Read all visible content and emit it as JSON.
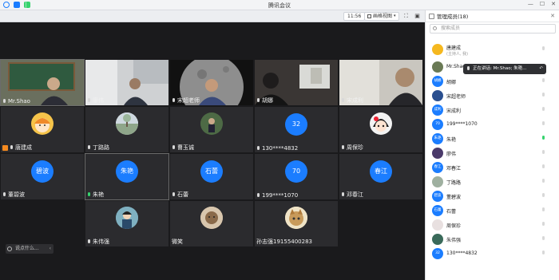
{
  "window": {
    "title": "腾讯会议",
    "close_symbol": "✕",
    "minimize_symbol": "—",
    "maximize_symbol": "☐"
  },
  "toolbar": {
    "time": "11:56",
    "view_label": "画格视图",
    "view_icon": "grid-icon"
  },
  "tiles": [
    {
      "name": "Mr.Shao",
      "kind": "video",
      "mic": "on"
    },
    {
      "name": "廖伟",
      "kind": "video",
      "mic": "on"
    },
    {
      "name": "宋超老师",
      "kind": "video",
      "mic": "on"
    },
    {
      "name": "胡娜",
      "kind": "video",
      "mic": "on"
    },
    {
      "name": "宋成利",
      "kind": "video",
      "mic": "on"
    },
    {
      "name": "唐建成",
      "kind": "avatar",
      "mic": "host"
    },
    {
      "name": "丁路路",
      "kind": "avatar",
      "mic": "on"
    },
    {
      "name": "曹玉诚",
      "kind": "avatar",
      "mic": "on"
    },
    {
      "name": "130****4832",
      "avatar_text": "32",
      "kind": "blue",
      "mic": "on"
    },
    {
      "name": "周保珍",
      "kind": "avatar",
      "mic": "on"
    },
    {
      "name": "董碧波",
      "avatar_text": "碧波",
      "kind": "blue",
      "mic": "on"
    },
    {
      "name": "朱艳",
      "avatar_text": "朱艳",
      "kind": "blue",
      "mic": "green"
    },
    {
      "name": "石蕾",
      "avatar_text": "石蕾",
      "kind": "blue",
      "mic": "on"
    },
    {
      "name": "199****1070",
      "avatar_text": "70",
      "kind": "blue",
      "mic": "on"
    },
    {
      "name": "邓春江",
      "avatar_text": "春江",
      "kind": "blue",
      "mic": "on"
    },
    {
      "name": "朱伟强",
      "kind": "avatar",
      "mic": "on"
    },
    {
      "name": "微笑",
      "kind": "avatar",
      "mic": "none"
    },
    {
      "name": "孙志强19155400283",
      "kind": "avatar",
      "mic": "none"
    }
  ],
  "chat": {
    "preview": "说点什么...",
    "chevron": "‹"
  },
  "panel": {
    "title": "管理成员(18)",
    "search_placeholder": "搜索成员",
    "close": "✕",
    "members": [
      {
        "name": "唐建成",
        "sub": "(主持人, 我)",
        "av": "",
        "avc": "#f5b81f"
      },
      {
        "name": "Mr.Shao",
        "av": "",
        "avc": "#6a7a55"
      },
      {
        "name": "胡娜",
        "av": "胡娜",
        "avc": "#1b7dff"
      },
      {
        "name": "宋超老师",
        "av": "",
        "avc": "#2a4f8f"
      },
      {
        "name": "宋成利",
        "av": "成利",
        "avc": "#1b7dff"
      },
      {
        "name": "199****1070",
        "av": "70",
        "avc": "#1b7dff"
      },
      {
        "name": "朱艳",
        "av": "朱艳",
        "avc": "#1b7dff"
      },
      {
        "name": "廖伟",
        "av": "",
        "avc": "#4a3a6a"
      },
      {
        "name": "邓春江",
        "av": "春江",
        "avc": "#1b7dff"
      },
      {
        "name": "丁路路",
        "av": "",
        "avc": "#9fb0a0"
      },
      {
        "name": "董碧波",
        "av": "碧波",
        "avc": "#1b7dff"
      },
      {
        "name": "石蕾",
        "av": "石蕾",
        "avc": "#1b7dff"
      },
      {
        "name": "周保珍",
        "av": "",
        "avc": "#e8e0e0"
      },
      {
        "name": "朱伟强",
        "av": "",
        "avc": "#3a6a5a"
      },
      {
        "name": "130****4832",
        "av": "32",
        "avc": "#1b7dff"
      }
    ]
  },
  "speaking_tip": {
    "text": "正在讲话: Mr.Shao; 朱艳...",
    "icon": "undo-icon",
    "symbol": "↶"
  },
  "colors": {
    "accent": "#1b7dff",
    "mic_on": "#37d36e",
    "mic_off": "#e5534b",
    "host": "#f58a1f"
  }
}
